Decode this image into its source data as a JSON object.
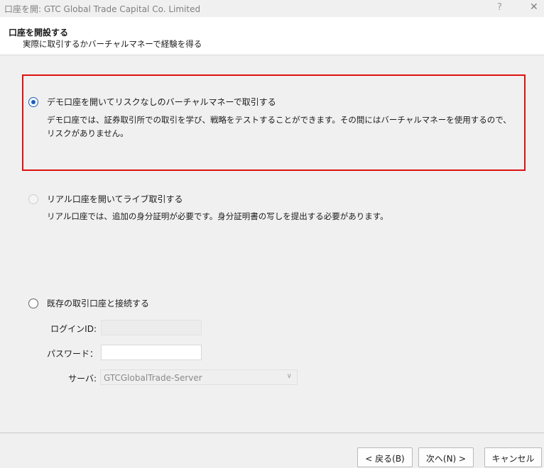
{
  "window": {
    "title": "口座を開: GTC Global Trade Capital Co. Limited",
    "help": "?",
    "close": "✕"
  },
  "header": {
    "title": "口座を開設する",
    "subtitle": "実際に取引するかバーチャルマネーで経験を得る"
  },
  "options": {
    "demo": {
      "label": "デモ口座を開いてリスクなしのバーチャルマネーで取引する",
      "description": "デモ口座では、証券取引所での取引を学び、戦略をテストすることができます。その間にはバーチャルマネーを使用するので、リスクがありません。",
      "selected": true
    },
    "real": {
      "label": "リアル口座を開いてライブ取引する",
      "description": "リアル口座では、追加の身分証明が必要です。身分証明書の写しを提出する必要があります。",
      "enabled": false
    },
    "existing": {
      "label": "既存の取引口座と接続する"
    }
  },
  "fields": {
    "login_label": "ログインID:",
    "login_value": "",
    "password_label": "パスワード：",
    "password_value": "",
    "server_label": "サーバ:",
    "server_value": "GTCGlobalTrade-Server"
  },
  "buttons": {
    "back": "< 戻る(B)",
    "next": "次へ(N) >",
    "cancel": "キャンセル"
  },
  "colors": {
    "highlight": "#e01010",
    "accent": "#1b5fbd"
  }
}
